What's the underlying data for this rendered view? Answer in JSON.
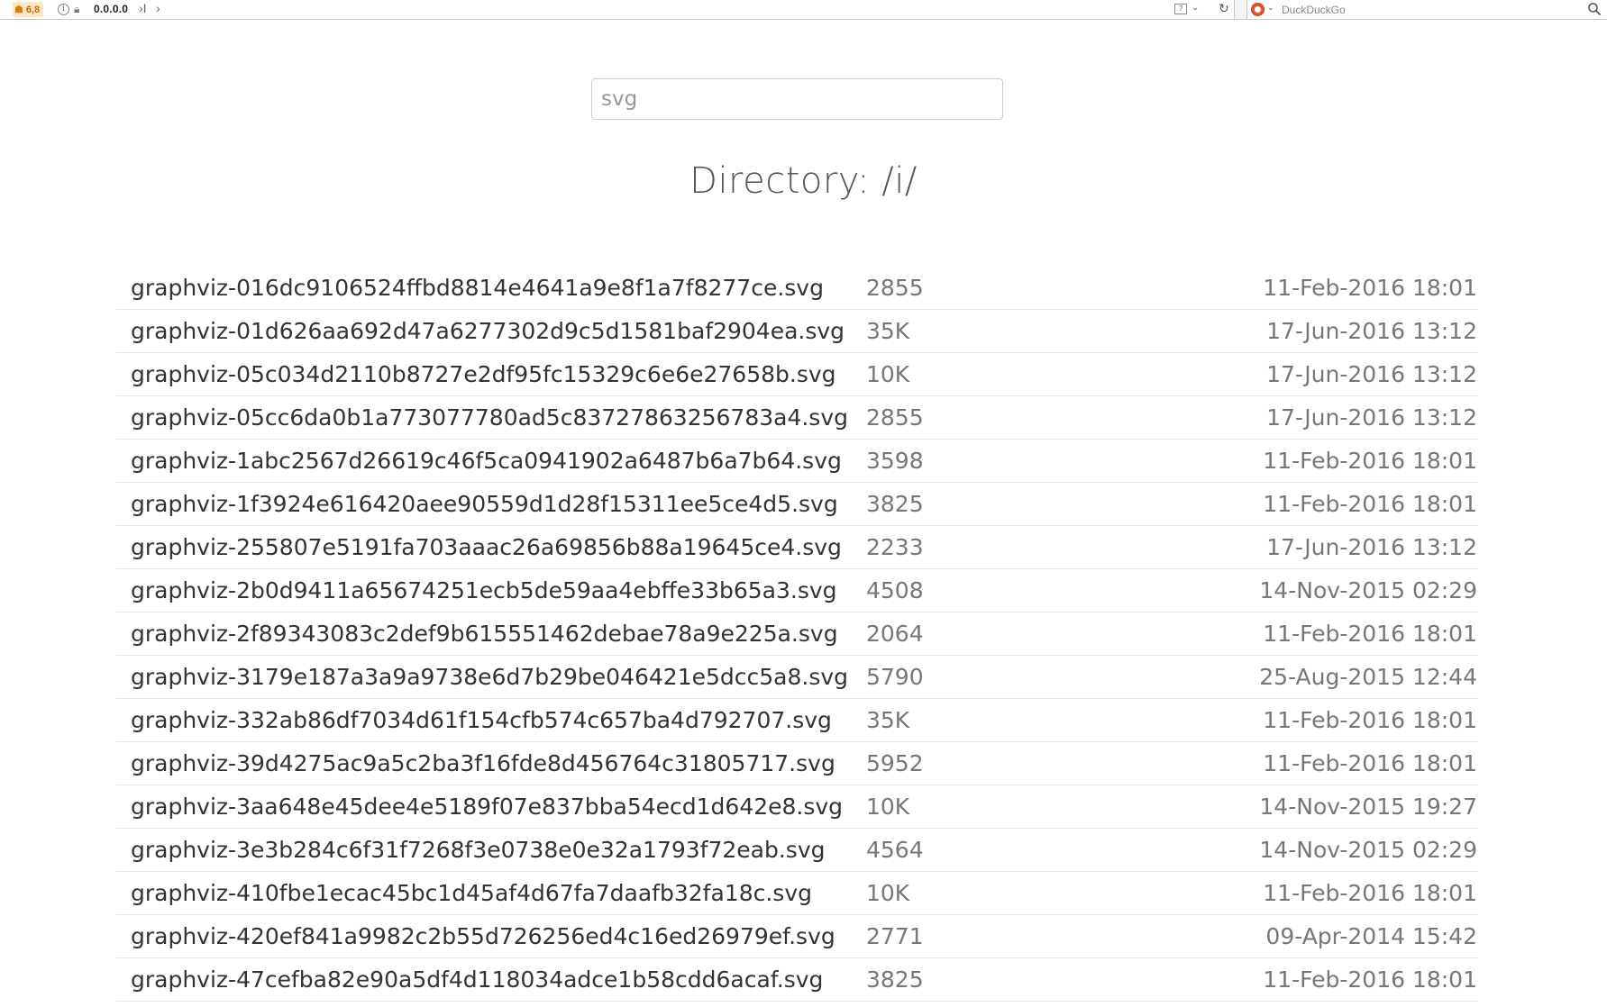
{
  "browser": {
    "ublock_count": "6,8",
    "url": "0.0.0.0",
    "url_tail": "›I",
    "forward_glyph": "›",
    "search_engine": "DuckDuckGo"
  },
  "search": {
    "value": "svg"
  },
  "page": {
    "title": "Directory: /i/"
  },
  "files": [
    {
      "name": "graphviz-016dc9106524ffbd8814e4641a9e8f1a7f8277ce.svg",
      "size": "2855",
      "date": "11-Feb-2016 18:01"
    },
    {
      "name": "graphviz-01d626aa692d47a6277302d9c5d1581baf2904ea.svg",
      "size": "35K",
      "date": "17-Jun-2016 13:12"
    },
    {
      "name": "graphviz-05c034d2110b8727e2df95fc15329c6e6e27658b.svg",
      "size": "10K",
      "date": "17-Jun-2016 13:12"
    },
    {
      "name": "graphviz-05cc6da0b1a773077780ad5c83727863256783a4.svg",
      "size": "2855",
      "date": "17-Jun-2016 13:12"
    },
    {
      "name": "graphviz-1abc2567d26619c46f5ca0941902a6487b6a7b64.svg",
      "size": "3598",
      "date": "11-Feb-2016 18:01"
    },
    {
      "name": "graphviz-1f3924e616420aee90559d1d28f15311ee5ce4d5.svg",
      "size": "3825",
      "date": "11-Feb-2016 18:01"
    },
    {
      "name": "graphviz-255807e5191fa703aaac26a69856b88a19645ce4.svg",
      "size": "2233",
      "date": "17-Jun-2016 13:12"
    },
    {
      "name": "graphviz-2b0d9411a65674251ecb5de59aa4ebffe33b65a3.svg",
      "size": "4508",
      "date": "14-Nov-2015 02:29"
    },
    {
      "name": "graphviz-2f89343083c2def9b615551462debae78a9e225a.svg",
      "size": "2064",
      "date": "11-Feb-2016 18:01"
    },
    {
      "name": "graphviz-3179e187a3a9a9738e6d7b29be046421e5dcc5a8.svg",
      "size": "5790",
      "date": "25-Aug-2015 12:44"
    },
    {
      "name": "graphviz-332ab86df7034d61f154cfb574c657ba4d792707.svg",
      "size": "35K",
      "date": "11-Feb-2016 18:01"
    },
    {
      "name": "graphviz-39d4275ac9a5c2ba3f16fde8d456764c31805717.svg",
      "size": "5952",
      "date": "11-Feb-2016 18:01"
    },
    {
      "name": "graphviz-3aa648e45dee4e5189f07e837bba54ecd1d642e8.svg",
      "size": "10K",
      "date": "14-Nov-2015 19:27"
    },
    {
      "name": "graphviz-3e3b284c6f31f7268f3e0738e0e32a1793f72eab.svg",
      "size": "4564",
      "date": "14-Nov-2015 02:29"
    },
    {
      "name": "graphviz-410fbe1ecac45bc1d45af4d67fa7daafb32fa18c.svg",
      "size": "10K",
      "date": "11-Feb-2016 18:01"
    },
    {
      "name": "graphviz-420ef841a9982c2b55d726256ed4c16ed26979ef.svg",
      "size": "2771",
      "date": "09-Apr-2014 15:42"
    },
    {
      "name": "graphviz-47cefba82e90a5df4d118034adce1b58cdd6acaf.svg",
      "size": "3825",
      "date": "11-Feb-2016 18:01"
    }
  ]
}
